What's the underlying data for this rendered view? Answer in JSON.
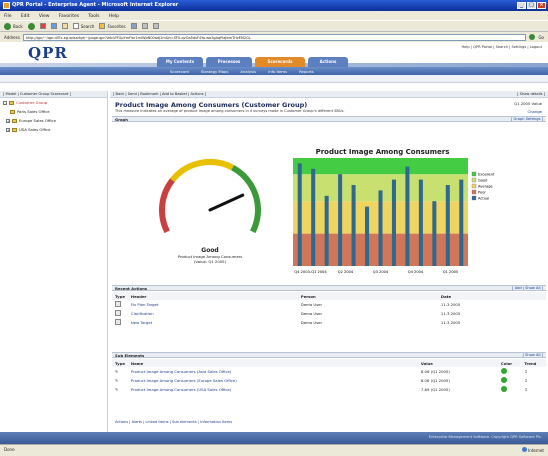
{
  "window": {
    "title": "QPR Portal - Enterprise Agent - Microsoft Internet Explorer"
  },
  "menu": [
    "File",
    "Edit",
    "View",
    "Favorites",
    "Tools",
    "Help"
  ],
  "toolbar": {
    "back": "Back",
    "search": "Search",
    "favorites": "Favorites"
  },
  "address": {
    "label": "Address",
    "url": "http://qpr/~/qpr.dll?x.eg.qdxsrtgt/~/page.qpr?wtcVfFGpYmFwr1mlWbN00adJ1m&h=SF0-qvOa5dsF4Ya-wa3gAqPlaJbmTHzEM2GL",
    "go": "Go"
  },
  "header": {
    "logo": "QPR",
    "toplinks": "Help  |  QPR Portal  |  Search  |  Settings  |  Logout",
    "tabs": [
      "My Contents",
      "Processes",
      "Scorecards",
      "Actions"
    ],
    "subtabs": [
      "Scorecard",
      "Strategy Maps",
      "Analysis",
      "Info Items",
      "Reports"
    ]
  },
  "sidebar": {
    "header": "[ Model | Customer Group Scorecard ]",
    "items": [
      "Customer Group",
      "Paris Sales Office",
      "Europe Sales Office",
      "USA Sales Office"
    ]
  },
  "main": {
    "header": "[ Back | Send | Bookmark | Add to Basket | Actions ]",
    "header_right": "[ Show details ]",
    "title": "Product Image Among Consumers (Customer Group)",
    "description": "This measure indicates an average of product image among consumers in 4 surveys made in Customer Group's different SBUs.",
    "right_info": "Q1 2005 Value",
    "right_change": "Change",
    "graph_section": "Graph",
    "graph_settings": "[ Graph Settings ]"
  },
  "gauge": {
    "status": "Good",
    "metric": "Product Image Among Consumers",
    "value_text": "(Value: Q1 2005)",
    "value_pct": 0.78,
    "colors": {
      "low": "#c84040",
      "mid": "#e8c000",
      "high": "#3a9a3a"
    }
  },
  "chart_data": {
    "type": "bar",
    "title": "Product Image Among Consumers",
    "categories": [
      "Q4 2003-Q1 2004",
      "Q2 2004",
      "Q3 2004",
      "Q4 2004",
      "Q1 2005"
    ],
    "values": [
      9.5,
      9.0,
      6.5,
      8.5,
      7.5,
      5.5,
      7.0,
      8.0,
      9.2,
      8.0,
      6.0,
      7.5,
      8.0
    ],
    "ylim": [
      0,
      10
    ],
    "bands": [
      {
        "from": 0,
        "to": 3,
        "color": "#d2765a"
      },
      {
        "from": 3,
        "to": 6,
        "color": "#f0d460"
      },
      {
        "from": 6,
        "to": 8.5,
        "color": "#c8e070"
      },
      {
        "from": 8.5,
        "to": 10,
        "color": "#44cc44"
      }
    ],
    "legend": [
      "Excellent",
      "Good",
      "Average",
      "Poor",
      "Actual"
    ],
    "legend_colors": [
      "#44cc44",
      "#c8e070",
      "#f0d460",
      "#d2765a",
      "#3a6a9a"
    ]
  },
  "recent_actions": {
    "title": "Recent Actions",
    "links": "[ Add | Show All ]",
    "columns": [
      "Type",
      "Header",
      "Person",
      "Date"
    ],
    "rows": [
      {
        "header": "Fix Plan Target",
        "person": "Demo User",
        "date": "11.3.2005"
      },
      {
        "header": "Clarification",
        "person": "Demo User",
        "date": "11.3.2005"
      },
      {
        "header": "New Target",
        "person": "Demo User",
        "date": "11.3.2005"
      }
    ]
  },
  "sub_elements": {
    "title": "Sub Elements",
    "links": "[ Show All ]",
    "columns": [
      "Type",
      "Name",
      "Value",
      "Color",
      "Trend"
    ],
    "rows": [
      {
        "name": "Product Image Among Consumers (Asia Sales Office)",
        "value": "8.06 (Q1 2005)"
      },
      {
        "name": "Product Image Among Consumers (Europe Sales Office)",
        "value": "8.08 (Q1 2005)"
      },
      {
        "name": "Product Image Among Consumers (USA Sales Office)",
        "value": "7.89 (Q1 2005)"
      }
    ]
  },
  "footer_links": "Actions | Alerts | Linked Items | Sub elements | Information Items",
  "copyright": "Enterprise Management Software. Copyright QPR Software Plc.",
  "statusbar": {
    "left": "Done",
    "right": "Internet"
  }
}
